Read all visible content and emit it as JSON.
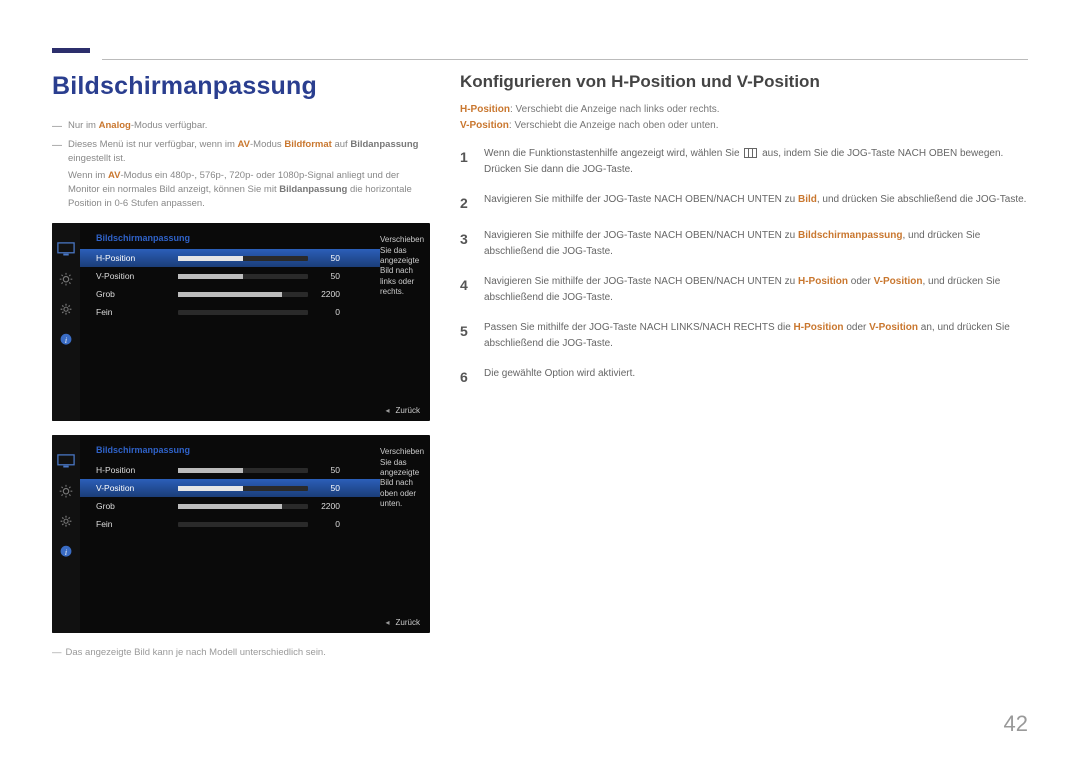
{
  "page_number": "42",
  "left": {
    "heading": "Bildschirmanpassung",
    "note1": {
      "pre": "Nur im ",
      "hl": "Analog",
      "post": "-Modus verfügbar."
    },
    "note2": {
      "pre": "Dieses Menü ist nur verfügbar, wenn im ",
      "hl1": "AV",
      "mid": "-Modus ",
      "hl2": "Bildformat",
      "post": " auf ",
      "hl3": "Bildanpassung",
      "post2": " eingestellt ist."
    },
    "note2b": {
      "pre": "Wenn im ",
      "hl1": "AV",
      "mid": "-Modus ein 480p-, 576p-, 720p- oder 1080p-Signal anliegt und der Monitor ein normales Bild anzeigt, können Sie mit ",
      "hl2": "Bildanpassung",
      "post": " die horizontale Position in 0-6 Stufen anpassen."
    },
    "footnote": "Das angezeigte Bild kann je nach Modell unterschiedlich sein."
  },
  "osd": {
    "title": "Bildschirmanpassung",
    "rows": [
      {
        "label": "H-Position",
        "value": "50",
        "fill": 50
      },
      {
        "label": "V-Position",
        "value": "50",
        "fill": 50
      },
      {
        "label": "Grob",
        "value": "2200",
        "fill": 80
      },
      {
        "label": "Fein",
        "value": "0",
        "fill": 0
      }
    ],
    "help1": "Verschieben Sie das angezeigte Bild nach links oder rechts.",
    "help2": "Verschieben Sie das angezeigte Bild nach oben oder unten.",
    "back": "Zurück"
  },
  "right": {
    "heading": "Konfigurieren von H-Position und V-Position",
    "def1": {
      "label": "H-Position",
      "text": ": Verschiebt die Anzeige nach links oder rechts."
    },
    "def2": {
      "label": "V-Position",
      "text": ": Verschiebt die Anzeige nach oben oder unten."
    },
    "steps": [
      {
        "pre": "Wenn die Funktionstastenhilfe angezeigt wird, wählen Sie ",
        "icon": true,
        "post": " aus, indem Sie die JOG-Taste NACH OBEN bewegen. Drücken Sie dann die JOG-Taste."
      },
      {
        "pre": "Navigieren Sie mithilfe der JOG-Taste NACH OBEN/NACH UNTEN zu ",
        "hl": "Bild",
        "post": ", und drücken Sie abschließend die JOG-Taste."
      },
      {
        "pre": "Navigieren Sie mithilfe der JOG-Taste NACH OBEN/NACH UNTEN zu ",
        "hl": "Bildschirmanpassung",
        "post": ", und drücken Sie abschließend die JOG-Taste."
      },
      {
        "pre": "Navigieren Sie mithilfe der JOG-Taste NACH OBEN/NACH UNTEN zu ",
        "hl": "H-Position",
        "mid": " oder ",
        "hl2": "V-Position",
        "post": ", und drücken Sie abschließend die JOG-Taste."
      },
      {
        "pre": "Passen Sie mithilfe der JOG-Taste NACH LINKS/NACH RECHTS die ",
        "hl": "H-Position",
        "mid": " oder ",
        "hl2": "V-Position",
        "post": " an, und drücken Sie abschließend die JOG-Taste."
      },
      {
        "pre": "Die gewählte Option wird aktiviert."
      }
    ]
  }
}
